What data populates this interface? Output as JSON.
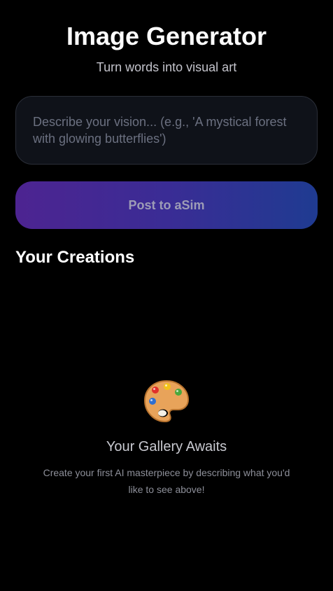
{
  "header": {
    "title": "Image Generator",
    "subtitle": "Turn words into visual art"
  },
  "prompt": {
    "value": "",
    "placeholder": "Describe your vision... (e.g., 'A mystical forest with glowing butterflies')"
  },
  "actions": {
    "post_label": "Post to aSim"
  },
  "gallery": {
    "section_title": "Your Creations",
    "empty_icon": "artist-palette-icon",
    "empty_title": "Your Gallery Awaits",
    "empty_description": "Create your first AI masterpiece by describing what you'd like to see above!"
  },
  "colors": {
    "background": "#000000",
    "button_gradient_start": "#4d2491",
    "button_gradient_end": "#1f3b91",
    "input_background": "#0f1219"
  }
}
